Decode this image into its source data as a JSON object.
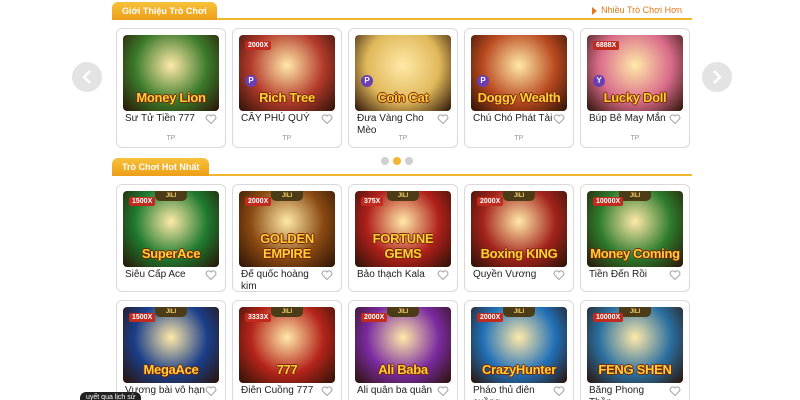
{
  "sections": {
    "intro": {
      "title": "Giới Thiệu Trò Chơi",
      "more": "Nhiều Trò Chơi Hơn"
    },
    "hot": {
      "title": "Trò Chơi Hot Nhất"
    }
  },
  "featured": [
    {
      "name": "Sư Tử Tiền 777",
      "logo": "Money Lion",
      "badge": "",
      "tag": "TP",
      "art_color": "#3a7a2a"
    },
    {
      "name": "CÂY PHÚ QUÝ",
      "logo": "Rich Tree",
      "badge": "2000X",
      "tag": "TP",
      "art_color": "#b33a2b"
    },
    {
      "name": "Đưa Vàng Cho Mèo",
      "logo": "Coin Cat",
      "badge": "",
      "tag": "TP",
      "art_color": "#e0b85a"
    },
    {
      "name": "Chú Chó Phát Tài",
      "logo": "Doggy Wealth",
      "badge": "",
      "tag": "TP",
      "art_color": "#b9491f"
    },
    {
      "name": "Búp Bê May Mắn",
      "logo": "Lucky Doll",
      "badge": "6888X",
      "tag": "TP",
      "art_color": "#d96b8a"
    }
  ],
  "carousel": {
    "dots": 3,
    "active_dot": 2
  },
  "hot_games": [
    {
      "name": "Siêu Cấp Ace",
      "logo": "SuperAce",
      "badge": "1500X",
      "art_color": "#1e7a2f"
    },
    {
      "name": "Đế quốc hoàng kim",
      "logo": "GOLDEN EMPIRE",
      "badge": "2000X",
      "art_color": "#8a4a12"
    },
    {
      "name": "Bảo thạch Kala",
      "logo": "FORTUNE GEMS",
      "badge": "375X",
      "art_color": "#b0201b"
    },
    {
      "name": "Quyền Vương",
      "logo": "Boxing KING",
      "badge": "2000X",
      "art_color": "#a3231c"
    },
    {
      "name": "Tiền Đến Rồi",
      "logo": "Money Coming",
      "badge": "10000X",
      "art_color": "#2c7a2c"
    },
    {
      "name": "Vương bài vô hạn",
      "logo": "MegaAce",
      "badge": "1500X",
      "art_color": "#1b3f8a"
    },
    {
      "name": "Điên Cuồng 777",
      "logo": "777",
      "badge": "3333X",
      "art_color": "#b5241b"
    },
    {
      "name": "Ali quân ba quân",
      "logo": "Ali Baba",
      "badge": "2000X",
      "art_color": "#7a2aa0"
    },
    {
      "name": "Pháo thủ điên cuồng",
      "logo": "CrazyHunter",
      "badge": "2000X",
      "art_color": "#2170b8"
    },
    {
      "name": "Băng Phong Thần",
      "logo": "FENG SHEN",
      "badge": "10000X",
      "art_color": "#2a6fa0"
    }
  ],
  "footer_chip": "uyết qua lịch sử",
  "icons": {
    "left": "chevron-left-icon",
    "right": "chevron-right-icon",
    "heart": "heart-outline-icon"
  },
  "colors": {
    "accent": "#f0b62e",
    "accent_dark": "#ee9e17",
    "link": "#e07a1a"
  }
}
